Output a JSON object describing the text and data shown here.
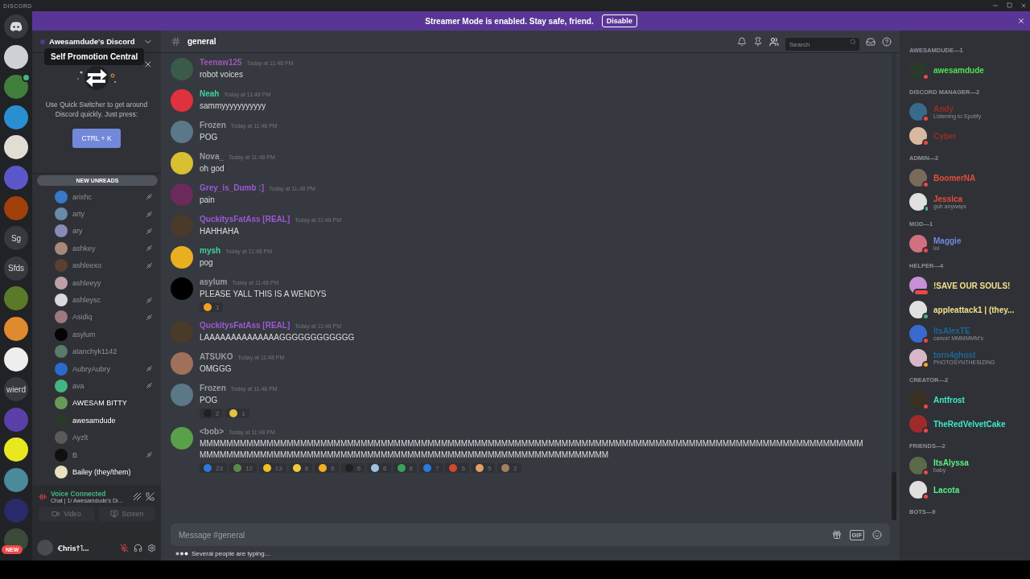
{
  "window": {
    "title": "DISCORD"
  },
  "banner": {
    "text": "Streamer Mode is enabled. Stay safe, friend.",
    "button": "Disable"
  },
  "servers": [
    {
      "kind": "home",
      "voice": false
    },
    {
      "kind": "picture",
      "color": "#cfd0d6",
      "voice": false,
      "tooltip": "Self Promotion Central"
    },
    {
      "kind": "picture",
      "color": "#3f7f3a",
      "voice": true
    },
    {
      "kind": "picture",
      "color": "#2a8fd0",
      "voice": false
    },
    {
      "kind": "picture",
      "color": "#e0ddd5",
      "voice": false
    },
    {
      "kind": "picture",
      "color": "#5a58c8",
      "voice": false
    },
    {
      "kind": "picture",
      "color": "#a0400a",
      "voice": false
    },
    {
      "kind": "text",
      "label": "Sg",
      "voice": false
    },
    {
      "kind": "text",
      "label": "Sfds",
      "voice": false
    },
    {
      "kind": "picture",
      "color": "#5a7a2a",
      "voice": false
    },
    {
      "kind": "picture",
      "color": "#e08a30",
      "voice": false
    },
    {
      "kind": "picture",
      "color": "#eeeeee",
      "voice": false
    },
    {
      "kind": "text",
      "label": "wierd",
      "voice": false
    },
    {
      "kind": "picture",
      "color": "#5b3fa8",
      "voice": false
    },
    {
      "kind": "picture",
      "color": "#e8e820",
      "voice": false
    },
    {
      "kind": "picture",
      "color": "#4a8a9a",
      "voice": false
    },
    {
      "kind": "picture",
      "color": "#2a2a6a",
      "voice": false
    },
    {
      "kind": "picture",
      "color": "#3a4a3a",
      "voice": false,
      "badge": "NEW"
    }
  ],
  "guild": {
    "name": "Awesamdude's Discord"
  },
  "quick_switcher": {
    "text": "Use Quick Switcher to get around Discord quickly. Just press:",
    "button": "CTRL + K"
  },
  "new_unreads": "NEW UNREADS",
  "voice_users": [
    {
      "name": "arixhc",
      "avatar": {
        "color": "#3a78c8"
      },
      "muted": true,
      "active": false
    },
    {
      "name": "arty",
      "avatar": {
        "color": "#6a8aa8"
      },
      "muted": true,
      "active": false
    },
    {
      "name": "ary",
      "avatar": {
        "color": "#8a8ab8"
      },
      "muted": true,
      "active": false
    },
    {
      "name": "ashkey",
      "avatar": {
        "color": "#a88878"
      },
      "muted": true,
      "active": false
    },
    {
      "name": "ashleexo",
      "avatar": {
        "color": "#5a4030"
      },
      "muted": true,
      "active": false
    },
    {
      "name": "ashleeyy",
      "avatar": {
        "color": "#c0a0a8"
      },
      "muted": false,
      "active": false
    },
    {
      "name": "ashleysc",
      "avatar": {
        "color": "#d8d8e0"
      },
      "muted": true,
      "active": false
    },
    {
      "name": "Asidiq",
      "avatar": {
        "color": "#a07880"
      },
      "muted": true,
      "active": false
    },
    {
      "name": "asylum",
      "avatar": {
        "color": "#050505"
      },
      "muted": false,
      "active": false
    },
    {
      "name": "atanchyk1142",
      "avatar": {
        "color": "#5a7a6a"
      },
      "muted": false,
      "active": false
    },
    {
      "name": "AubryAubry",
      "avatar": {
        "color": "#2a6ad0"
      },
      "muted": true,
      "active": false
    },
    {
      "name": "ava",
      "avatar": {
        "color": "#43b581"
      },
      "muted": true,
      "active": false
    },
    {
      "name": "AWESAM BITTY",
      "avatar": {
        "color": "#6a9a5a"
      },
      "muted": false,
      "active": true
    },
    {
      "name": "awesamdude",
      "avatar": {
        "color": "#2a3a2a"
      },
      "muted": false,
      "active": true
    },
    {
      "name": "Ayzlt",
      "avatar": {
        "color": "#5a5a5a"
      },
      "muted": false,
      "active": false
    },
    {
      "name": "B",
      "avatar": {
        "color": "#101010"
      },
      "muted": true,
      "active": false
    },
    {
      "name": "Bailey (they/them)",
      "avatar": {
        "color": "#e8e0c0"
      },
      "muted": false,
      "active": true
    }
  ],
  "voice_panel": {
    "status": "Voice Connected",
    "channel": "Chat | 1/ Awesamdude's Di...",
    "buttons": [
      "Video",
      "Screen"
    ]
  },
  "user_panel": {
    "name": "Ꞓhris†˥...",
    "avatar": {
      "color": "#4a4a52"
    }
  },
  "channel": {
    "name": "general",
    "search": {
      "placeholder": "Search"
    }
  },
  "messages": [
    {
      "author": "Teenaw125",
      "color": "#9b59b6",
      "avatar": {
        "color": "#3a5a4a"
      },
      "time": "Today at 11:48 PM",
      "text": "robot voices"
    },
    {
      "author": "Neah",
      "color": "#43d19e",
      "avatar": {
        "color": "#e0323e"
      },
      "time": "Today at 11:48 PM",
      "text": "sammyyyyyyyyyyy"
    },
    {
      "author": "Frozen",
      "color": "#9a9ca0",
      "avatar": {
        "color": "#5a7888"
      },
      "time": "Today at 11:48 PM",
      "text": "POG"
    },
    {
      "author": "Nova_",
      "color": "#9a9ca0",
      "avatar": {
        "color": "#d8c030"
      },
      "time": "Today at 11:48 PM",
      "text": "oh god"
    },
    {
      "author": "Grey_is_Dumb :]",
      "color": "#9b59d6",
      "avatar": {
        "color": "#6a2a5a"
      },
      "time": "Today at 11:48 PM",
      "text": "pain"
    },
    {
      "author": "QuckitysFatAss [REAL]",
      "color": "#9b59d6",
      "avatar": {
        "color": "#4a3a2a"
      },
      "time": "Today at 11:48 PM",
      "text": "HAHHAHA"
    },
    {
      "author": "mysh",
      "color": "#43d19e",
      "avatar": {
        "color": "#e8b020"
      },
      "time": "Today at 11:48 PM",
      "text": "pog"
    },
    {
      "author": "asylum",
      "color": "#9a9ca0",
      "avatar": {
        "color": "#000000"
      },
      "time": "Today at 11:48 PM",
      "text": "PLEASE YALL THIS IS A WENDYS",
      "reactions": [
        {
          "color": "#f0a020",
          "count": "1"
        }
      ]
    },
    {
      "author": "QuckitysFatAss [REAL]",
      "color": "#9b59d6",
      "avatar": {
        "color": "#4a3a2a"
      },
      "time": "Today at 11:48 PM",
      "text": "LAAAAAAAAAAAAAAGGGGGGGGGGGG"
    },
    {
      "author": "ATSUKO",
      "color": "#9a9ca0",
      "avatar": {
        "color": "#a0705a"
      },
      "time": "Today at 11:48 PM",
      "text": "OMGGG"
    },
    {
      "author": "Frozen",
      "color": "#9a9ca0",
      "avatar": {
        "color": "#5a7888"
      },
      "time": "Today at 11:48 PM",
      "text": "POG",
      "reactions": [
        {
          "color": "#202020",
          "count": "2"
        },
        {
          "color": "#e8c040",
          "count": "1"
        }
      ]
    },
    {
      "author": "<bob>",
      "color": "#9a9ca0",
      "avatar": {
        "color": "#5aa04a"
      },
      "time": "Today at 11:48 PM",
      "text": "MMMMMMMMMMMMMMMMMMMMMMMMMMMMMMMMMMMMMMMMMMMMMMMMMMMMMMMMMMMMMMMMMMMMMMMMMMMMMMMMMMMMMMMMMMMMMMMMMMMMMMMMMMMMMMMMMMMMMMMMMMMMMMMMMMMMMMMMMMMMMMMMMMMMMMMMMMMMMMMM",
      "reactions": [
        {
          "color": "#2a7ad8",
          "count": "23"
        },
        {
          "color": "#5a8a4a",
          "count": "12"
        },
        {
          "color": "#f0c020",
          "count": "13"
        },
        {
          "color": "#f0c840",
          "count": "8"
        },
        {
          "color": "#f0b020",
          "count": "6"
        },
        {
          "color": "#202020",
          "count": "6"
        },
        {
          "color": "#a0c0e0",
          "count": "6"
        },
        {
          "color": "#3aa05a",
          "count": "8"
        },
        {
          "color": "#2a7ad8",
          "count": "7"
        },
        {
          "color": "#d04a2a",
          "count": "5"
        },
        {
          "color": "#e0a060",
          "count": "5"
        },
        {
          "color": "#a08060",
          "count": "2"
        }
      ]
    }
  ],
  "composer": {
    "placeholder": "Message #general",
    "gif": "GIF"
  },
  "typing": "Several people are typing...",
  "member_groups": [
    {
      "title": "AWESAMDUDE—1",
      "members": [
        {
          "name": "awesamdude",
          "color": "#4de14d",
          "avatar": {
            "color": "#2a3a2a"
          },
          "kind": "dnd"
        }
      ]
    },
    {
      "title": "DISCORD MANAGER—2",
      "members": [
        {
          "name": "Andy",
          "color": "#992d22",
          "avatar": {
            "color": "#3a6a8a"
          },
          "kind": "dnd",
          "activity": "Listening to Spotify"
        },
        {
          "name": "Cyber",
          "color": "#992d22",
          "avatar": {
            "color": "#d8b8a0"
          },
          "kind": "dnd"
        }
      ]
    },
    {
      "title": "ADMIN—2",
      "members": [
        {
          "name": "BoomerNA",
          "color": "#e74c3c",
          "avatar": {
            "color": "#7a6a5a"
          },
          "kind": "dnd"
        },
        {
          "name": "Jessica",
          "color": "#e74c3c",
          "avatar": {
            "color": "#e0e0e0"
          },
          "kind": "mobile",
          "activity": "guh anyways"
        }
      ]
    },
    {
      "title": "MOD—1",
      "members": [
        {
          "name": "Maggie",
          "color": "#7289da",
          "avatar": {
            "color": "#d07080"
          },
          "kind": "dnd",
          "activity": "lol"
        }
      ]
    },
    {
      "title": "HELPER—4",
      "members": [
        {
          "name": "!SAVE OUR SOULS!",
          "color": "#f1e08a",
          "avatar": {
            "color": "#c890d8"
          },
          "kind": "typing"
        },
        {
          "name": "appleattack1 | (they...",
          "color": "#f1e08a",
          "avatar": {
            "color": "#e0e0e0"
          },
          "kind": "online"
        },
        {
          "name": "ItsAlexTE",
          "color": "#206694",
          "avatar": {
            "color": "#3a6ad0"
          },
          "kind": "dnd",
          "activity": "cancel MMMMMM's"
        },
        {
          "name": "torn4ghost",
          "color": "#206694",
          "avatar": {
            "color": "#d8b8c8"
          },
          "kind": "idle",
          "activity": "PHOTOSYNTHESIZING"
        }
      ]
    },
    {
      "title": "CREATOR—2",
      "members": [
        {
          "name": "Antfrost",
          "color": "#3ee8c8",
          "avatar": {
            "color": "#3a3020"
          },
          "kind": "dnd"
        },
        {
          "name": "TheRedVelvetCake",
          "color": "#3ee8c8",
          "avatar": {
            "color": "#a02a2a"
          },
          "kind": "dnd"
        }
      ]
    },
    {
      "title": "FRIENDS—2",
      "members": [
        {
          "name": "ItsAlyssa",
          "color": "#57f287",
          "avatar": {
            "color": "#5a6a4a"
          },
          "kind": "dnd",
          "activity": "baby"
        },
        {
          "name": "Lacota",
          "color": "#57f287",
          "avatar": {
            "color": "#e0e0e0"
          },
          "kind": "dnd"
        }
      ]
    },
    {
      "title": "BOTS—9"
    }
  ]
}
